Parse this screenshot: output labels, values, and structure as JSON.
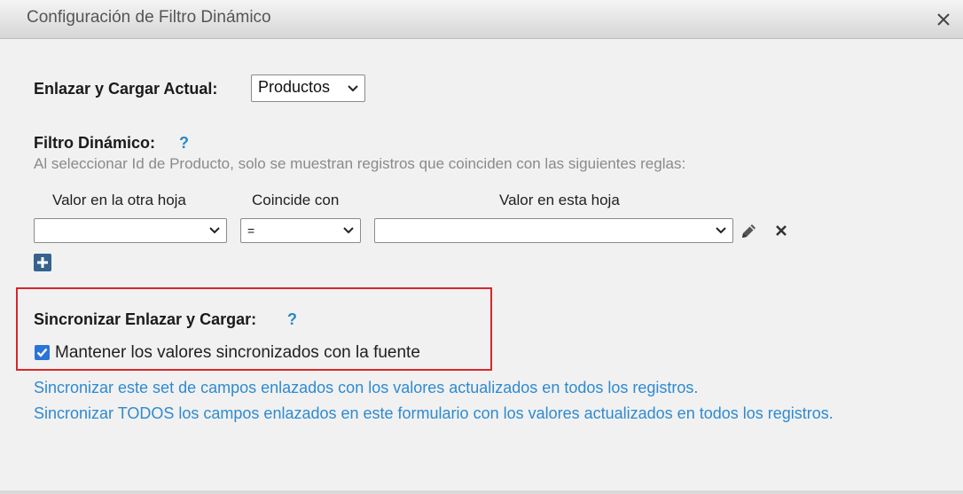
{
  "dialog": {
    "title": "Configuración de Filtro Dinámico"
  },
  "link_load": {
    "label": "Enlazar y Cargar Actual:",
    "selected": "Productos"
  },
  "dynamic_filter": {
    "label": "Filtro Dinámico:",
    "help": "?",
    "description": "Al seleccionar Id de Producto, solo se muestran registros que coinciden con las siguientes reglas:",
    "columns": {
      "other_sheet": "Valor en la otra hoja",
      "matches": "Coincide con",
      "this_sheet": "Valor en esta hoja"
    },
    "rule": {
      "other_sheet_value": "",
      "operator": "=",
      "this_sheet_value": ""
    }
  },
  "sync": {
    "label": "Sincronizar Enlazar y Cargar:",
    "help": "?",
    "checkbox_label": "Mantener los valores sincronizados con la fuente",
    "checked": true,
    "link_this_set": "Sincronizar este set de campos enlazados con los valores actualizados en todos los registros.",
    "link_all": "Sincronizar TODOS los campos enlazados en este formulario con los valores actualizados en todos los registros."
  },
  "colors": {
    "accent_link": "#2e8ad0",
    "help": "#2688c7",
    "highlight_border": "#d8262b",
    "add_button": "#36628e",
    "checkbox": "#2a73d8"
  }
}
